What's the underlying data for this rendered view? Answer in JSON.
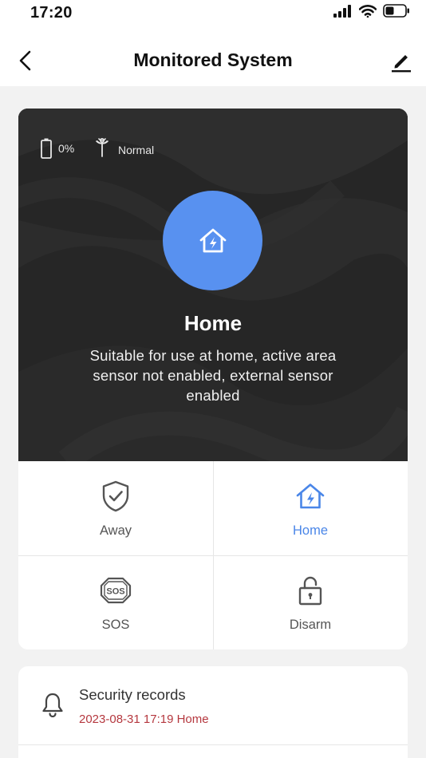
{
  "status_bar": {
    "time": "17:20"
  },
  "nav": {
    "title": "Monitored System"
  },
  "device": {
    "battery_text": "0%",
    "battery_level": 0,
    "signal_text": "Normal"
  },
  "mode": {
    "title": "Home",
    "description": "Suitable for use at home, active area sensor not enabled, external sensor enabled"
  },
  "modes": [
    {
      "label": "Away",
      "icon": "shield-check-icon",
      "active": false
    },
    {
      "label": "Home",
      "icon": "home-bolt-icon",
      "active": true
    },
    {
      "label": "SOS",
      "icon": "sos-icon",
      "active": false
    },
    {
      "label": "Disarm",
      "icon": "unlock-icon",
      "active": false
    }
  ],
  "records": {
    "title": "Security records",
    "latest": "2023-08-31 17:19 Home"
  },
  "colors": {
    "accent": "#4a86e8",
    "mode_circle": "#5891f0",
    "hero_bg": "#262626",
    "record_text": "#b5383f"
  }
}
